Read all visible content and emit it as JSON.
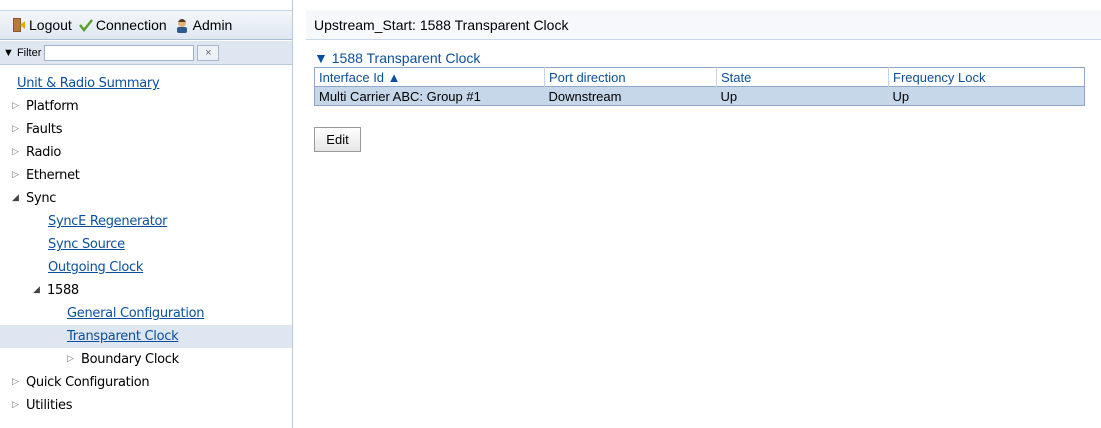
{
  "toolbar": {
    "logout_label": "Logout",
    "connection_label": "Connection",
    "admin_label": "Admin"
  },
  "filter": {
    "label": "▼ Filter",
    "value": "",
    "clear_label": "×"
  },
  "tree": {
    "unit_radio_summary": "Unit & Radio Summary",
    "platform": "Platform",
    "faults": "Faults",
    "radio": "Radio",
    "ethernet": "Ethernet",
    "sync": "Sync",
    "synce_regenerator": "SyncE Regenerator",
    "sync_source": "Sync Source",
    "outgoing_clock": "Outgoing Clock",
    "n1588": "1588",
    "general_configuration": "General Configuration",
    "transparent_clock": "Transparent Clock",
    "boundary_clock": "Boundary Clock",
    "quick_configuration": "Quick Configuration",
    "utilities": "Utilities"
  },
  "main": {
    "title": "Upstream_Start: 1588 Transparent Clock",
    "section_label": "▼ 1588 Transparent Clock",
    "columns": [
      "Interface Id ▲",
      "Port direction",
      "State",
      "Frequency Lock"
    ],
    "rows": [
      [
        "Multi Carrier ABC: Group #1",
        "Downstream",
        "Up",
        "Up"
      ]
    ],
    "edit_label": "Edit"
  },
  "colors": {
    "link": "#0b4f9c",
    "selected_row": "#c6d7ea",
    "selected_tree": "#dde6f1",
    "connection_check": "#5aa02c"
  }
}
